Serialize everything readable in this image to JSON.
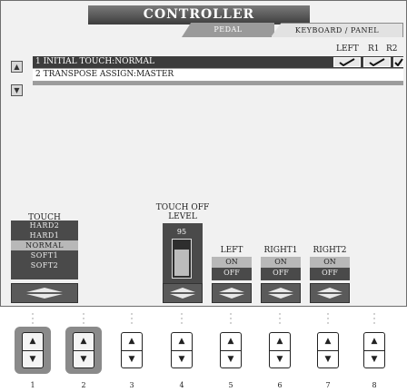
{
  "header": {
    "title": "CONTROLLER"
  },
  "tabs": [
    {
      "label": "PEDAL"
    },
    {
      "label": "KEYBOARD / PANEL"
    }
  ],
  "columns": {
    "left": "LEFT",
    "r1": "R1",
    "r2": "R2"
  },
  "list": {
    "items": [
      {
        "label": "1 INITIAL TOUCH:NORMAL",
        "selected": true
      },
      {
        "label": "2 TRANSPOSE ASSIGN:MASTER",
        "selected": false
      }
    ]
  },
  "touch": {
    "label": "TOUCH",
    "options": [
      "HARD2",
      "HARD1",
      "NORMAL",
      "SOFT1",
      "SOFT2"
    ],
    "selected": "NORMAL"
  },
  "touch_off": {
    "label_line1": "TOUCH OFF",
    "label_line2": "LEVEL",
    "value": "95",
    "level_fraction": 0.75
  },
  "parts": [
    {
      "label": "LEFT",
      "on": "ON",
      "off": "OFF"
    },
    {
      "label": "RIGHT1",
      "on": "ON",
      "off": "OFF"
    },
    {
      "label": "RIGHT2",
      "on": "ON",
      "off": "OFF"
    }
  ],
  "buttons": {
    "numbers": [
      "1",
      "2",
      "3",
      "4",
      "5",
      "6",
      "7",
      "8"
    ],
    "up_icon": "triangle-up-icon",
    "down_icon": "triangle-down-icon"
  }
}
